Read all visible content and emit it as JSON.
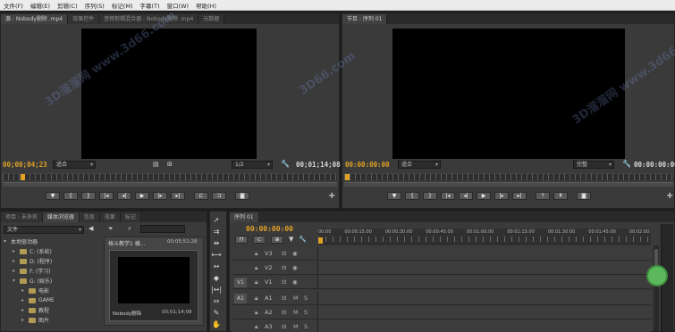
{
  "menu": [
    "文件(F)",
    "编辑(E)",
    "剪辑(C)",
    "序列(S)",
    "标记(M)",
    "字幕(T)",
    "窗口(W)",
    "帮助(H)"
  ],
  "source_monitor": {
    "tabs": [
      "源 : Nobody删除 .mp4",
      "效果控件",
      "音频剪辑混合器 : Nobody删除 .mp4",
      "元数据"
    ],
    "timecode_in": "00;00;04;23",
    "fit": "适合",
    "resolution": "1/2",
    "timecode_out": "00;01;14;08"
  },
  "program_monitor": {
    "tab": "节目 : 序列 01",
    "timecode_in": "00:00:00:00",
    "fit": "适合",
    "resolution": "完整",
    "timecode_out": "00:00:00:00"
  },
  "transport_icons": [
    "marker-icon",
    "in-point-icon",
    "out-point-icon",
    "go-to-in-icon",
    "step-back-icon",
    "play-icon",
    "step-forward-icon",
    "go-to-out-icon",
    "insert-icon",
    "overwrite-icon",
    "export-frame-icon"
  ],
  "project_panel": {
    "tabs": [
      "项目 : 未命名",
      "媒体浏览器",
      "信息",
      "效果",
      "标记"
    ],
    "view_dropdown": "文件",
    "root": "本地驱动器",
    "drives": [
      "C: (系统)",
      "D: (程序)",
      "F: (学习)",
      "G: (娱乐)"
    ],
    "subfolders": [
      "电影",
      "GAME",
      "教程",
      "图片"
    ],
    "preview_title": "格斗教学1 横...",
    "preview_timecode": "00;05;51;28",
    "thumb_name": "Nobody删除",
    "thumb_duration": "00;01;14;08"
  },
  "timeline": {
    "tab": "序列 01",
    "timecode": "00:00:00:00",
    "ruler_labels": [
      "00:00",
      "00:00:15:00",
      "00:00:30:00",
      "00:00:45:00",
      "00:01:00:00",
      "00:01:15:00",
      "00:01:30:00",
      "00:01:45:00",
      "00:02:00:"
    ],
    "video_tracks": [
      "V3",
      "V2",
      "V1"
    ],
    "audio_tracks": [
      "A1",
      "A2",
      "A3"
    ],
    "source_video_label": "V1",
    "source_audio_label": "A1",
    "mute_label": "M",
    "solo_label": "S"
  },
  "tools": [
    "selection-tool",
    "track-select-tool",
    "ripple-edit-tool",
    "rolling-edit-tool",
    "rate-stretch-tool",
    "razor-tool",
    "slip-tool",
    "slide-tool",
    "pen-tool",
    "hand-tool",
    "zoom-tool"
  ],
  "watermarks": [
    "3D溜溜网 www.3d66.com",
    "3D66.com",
    "3D溜溜网 www.3d66.com"
  ]
}
